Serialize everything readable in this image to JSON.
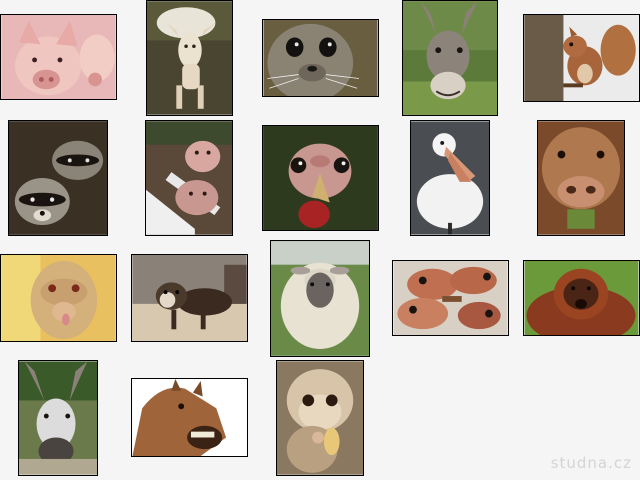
{
  "watermark": "studna.cz",
  "photos": [
    {
      "subject": "pig",
      "bg": "#e8b8b8",
      "fg": "#f0c2bc",
      "accent": "#a85c5c"
    },
    {
      "subject": "goat",
      "bg": "#4a4530",
      "fg": "#e8dcc8",
      "accent": "#2a2418"
    },
    {
      "subject": "seal",
      "bg": "#6a5e40",
      "fg": "#8a8272",
      "accent": "#1a1814"
    },
    {
      "subject": "donkey",
      "bg": "#5c7a3a",
      "fg": "#8c847a",
      "accent": "#3a3228"
    },
    {
      "subject": "squirrel",
      "bg": "#ebebeb",
      "fg": "#a8643a",
      "accent": "#5a3a20"
    },
    {
      "subject": "raccoons",
      "bg": "#3a3024",
      "fg": "#8a8478",
      "accent": "#1a1410"
    },
    {
      "subject": "calf",
      "bg": "#5a4838",
      "fg": "#d8a8a0",
      "accent": "#efefef"
    },
    {
      "subject": "turkey",
      "bg": "#2e3a1e",
      "fg": "#c89890",
      "accent": "#a82424"
    },
    {
      "subject": "pelican",
      "bg": "#4a4e52",
      "fg": "#f2f2f2",
      "accent": "#d89878"
    },
    {
      "subject": "cow",
      "bg": "#7a4a2a",
      "fg": "#b0784e",
      "accent": "#4a2818"
    },
    {
      "subject": "monkey",
      "bg": "#e8c060",
      "fg": "#c8a070",
      "accent": "#7a4a30"
    },
    {
      "subject": "ferret",
      "bg": "#8a8278",
      "fg": "#3a2a20",
      "accent": "#d8c8b0"
    },
    {
      "subject": "sheep",
      "bg": "#6a8a48",
      "fg": "#e8e2d2",
      "accent": "#5a5450"
    },
    {
      "subject": "fish",
      "bg": "#d8d0c4",
      "fg": "#c07050",
      "accent": "#7a5030"
    },
    {
      "subject": "orangutan",
      "bg": "#6a9a3a",
      "fg": "#8a3a1e",
      "accent": "#3a1a0e"
    },
    {
      "subject": "donkey",
      "bg": "#6a7a4a",
      "fg": "#dcdcdc",
      "accent": "#4a4440"
    },
    {
      "subject": "horse",
      "bg": "#ffffff",
      "fg": "#a0643a",
      "accent": "#3a2214"
    },
    {
      "subject": "baby-monkey",
      "bg": "#8a7860",
      "fg": "#d8c4a8",
      "accent": "#5a4430"
    }
  ]
}
